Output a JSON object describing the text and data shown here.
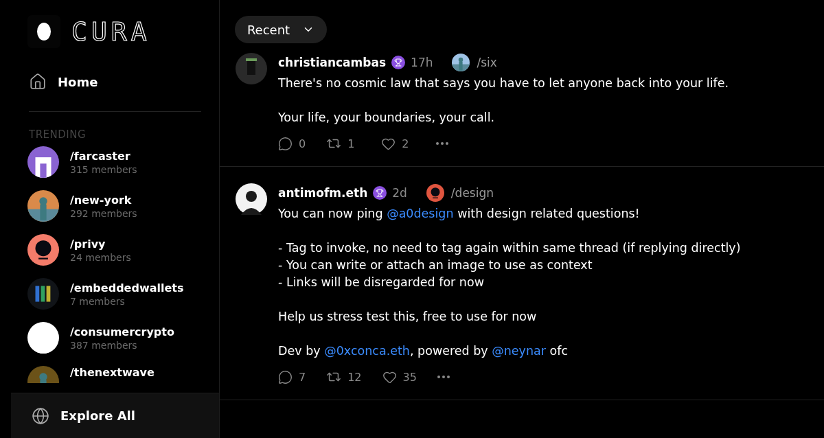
{
  "logo": {
    "wordmark": "CURA"
  },
  "nav": [
    {
      "label": "Home",
      "kind": "home",
      "selected": true
    }
  ],
  "trending": {
    "heading": "TRENDING",
    "channels": [
      {
        "name": "/farcaster",
        "members": "315 members",
        "color": "#8a63d2"
      },
      {
        "name": "/new-york",
        "members": "292 members",
        "color": "#d98a4a"
      },
      {
        "name": "/privy",
        "members": "24 members",
        "color": "#f47c6a"
      },
      {
        "name": "/embeddedwallets",
        "members": "7 members",
        "color": "#111418"
      },
      {
        "name": "/consumercrypto",
        "members": "387 members",
        "color": "#ffffff"
      },
      {
        "name": "/thenextwave",
        "color": "#6b5218"
      }
    ]
  },
  "explore": {
    "label": "Explore All"
  },
  "feed_filter": {
    "label": "Recent"
  },
  "posts": [
    {
      "author": "christiancambas",
      "time": "17h",
      "channel": "/six",
      "body": [
        [
          [
            {
              "text": "There's no cosmic law that says you have to let anyone back into your life."
            }
          ]
        ],
        [
          [
            {
              "text": "Your life, your boundaries, your call."
            }
          ]
        ]
      ],
      "replies": "0",
      "recasts": "1",
      "likes": "2"
    },
    {
      "author": "antimofm.eth",
      "time": "2d",
      "channel": "/design",
      "body": [
        [
          [
            {
              "text": "You can now ping "
            },
            {
              "text": "@a0design",
              "kind": "mention"
            },
            {
              "text": " with design related questions!"
            }
          ]
        ],
        [
          [
            {
              "text": "- Tag to invoke, no need to tag again within same thread (if replying directly)"
            }
          ],
          [
            {
              "text": "- You can write or attach an image to use as context"
            }
          ],
          [
            {
              "text": "- Links will be disregarded for now"
            }
          ]
        ],
        [
          [
            {
              "text": "Help us stress test this, free to use for now"
            }
          ]
        ],
        [
          [
            {
              "text": "Dev by "
            },
            {
              "text": "@0xconca.eth",
              "kind": "mention"
            },
            {
              "text": ", powered by "
            },
            {
              "text": "@neynar",
              "kind": "mention"
            },
            {
              "text": " ofc"
            }
          ]
        ]
      ],
      "replies": "7",
      "recasts": "12",
      "likes": "35"
    }
  ]
}
